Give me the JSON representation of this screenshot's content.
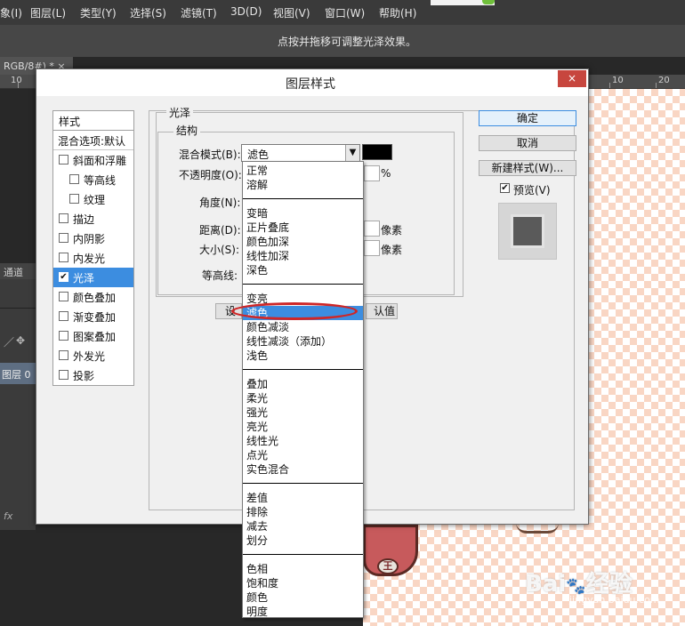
{
  "menubar": {
    "items": [
      "象(I)",
      "图层(L)",
      "类型(Y)",
      "选择(S)",
      "滤镜(T)",
      "3D(D)",
      "视图(V)",
      "窗口(W)",
      "帮助(H)"
    ]
  },
  "options_bar": {
    "hint": "点按并拖移可调整光泽效果。"
  },
  "document_tab": {
    "label": "RGB/8#) * ×"
  },
  "rulers": {
    "labels": [
      "10",
      "10",
      "20"
    ]
  },
  "layers_panel": {
    "tab": "通道",
    "layer_label": "图层 0",
    "fx_label": "fx"
  },
  "dialog": {
    "title": "图层样式",
    "close_label": "×",
    "styles_header": "样式",
    "blend_options": "混合选项:默认",
    "styles": [
      {
        "label": "斜面和浮雕",
        "checked": false,
        "indent": false,
        "selected": false
      },
      {
        "label": "等高线",
        "checked": false,
        "indent": true,
        "selected": false
      },
      {
        "label": "纹理",
        "checked": false,
        "indent": true,
        "selected": false
      },
      {
        "label": "描边",
        "checked": false,
        "indent": false,
        "selected": false
      },
      {
        "label": "内阴影",
        "checked": false,
        "indent": false,
        "selected": false
      },
      {
        "label": "内发光",
        "checked": false,
        "indent": false,
        "selected": false
      },
      {
        "label": "光泽",
        "checked": true,
        "indent": false,
        "selected": true
      },
      {
        "label": "颜色叠加",
        "checked": false,
        "indent": false,
        "selected": false
      },
      {
        "label": "渐变叠加",
        "checked": false,
        "indent": false,
        "selected": false
      },
      {
        "label": "图案叠加",
        "checked": false,
        "indent": false,
        "selected": false
      },
      {
        "label": "外发光",
        "checked": false,
        "indent": false,
        "selected": false
      },
      {
        "label": "投影",
        "checked": false,
        "indent": false,
        "selected": false
      }
    ],
    "group_title": "光泽",
    "structure_title": "结构",
    "blend_mode_label": "混合模式(B):",
    "blend_mode_value": "滤色",
    "opacity_label": "不透明度(O):",
    "opacity_unit": "%",
    "angle_label": "角度(N):",
    "distance_label": "距离(D):",
    "distance_unit": "像素",
    "size_label": "大小(S):",
    "size_unit": "像素",
    "contour_label": "等高线:",
    "set_default_partial": "设",
    "reset_default_partial": "认值",
    "buttons": {
      "ok": "确定",
      "cancel": "取消",
      "new_style": "新建样式(W)..."
    },
    "preview_label": "预览(V)",
    "preview_checked": true,
    "swatch_color": "#000000"
  },
  "blend_dropdown": {
    "selected": "滤色",
    "groups": [
      [
        "正常",
        "溶解"
      ],
      [
        "变暗",
        "正片叠底",
        "颜色加深",
        "线性加深",
        "深色"
      ],
      [
        "变亮",
        "滤色",
        "颜色减淡",
        "线性减淡（添加）",
        "浅色"
      ],
      [
        "叠加",
        "柔光",
        "强光",
        "亮光",
        "线性光",
        "点光",
        "实色混合"
      ],
      [
        "差值",
        "排除",
        "减去",
        "划分"
      ],
      [
        "色相",
        "饱和度",
        "颜色",
        "明度"
      ]
    ]
  },
  "canvas": {
    "sticker_badge": "王"
  },
  "watermark": {
    "text": "Bai",
    "text2": "经验",
    "sub": "jingyan.baidu.com"
  },
  "colors": {
    "accent": "#3c8de0",
    "close": "#c7463e",
    "highlight": "#cf2626"
  }
}
